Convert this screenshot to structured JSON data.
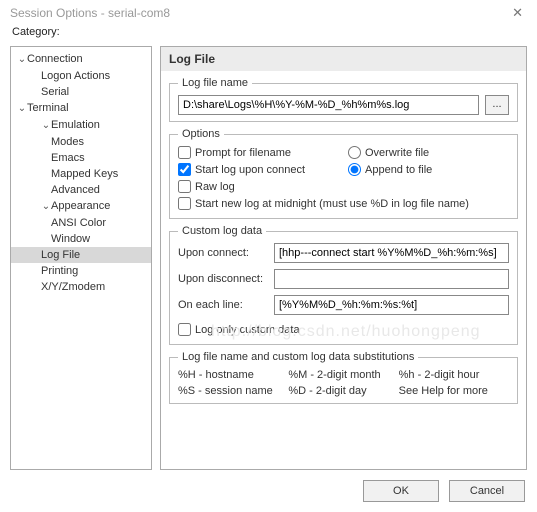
{
  "window": {
    "title": "Session Options - serial-com8",
    "close_glyph": "✕"
  },
  "sidebar": {
    "label": "Category:",
    "tree": {
      "connection": {
        "label": "Connection",
        "children": {
          "logon": "Logon Actions",
          "serial": "Serial"
        }
      },
      "terminal": {
        "label": "Terminal",
        "children": {
          "emulation": {
            "label": "Emulation",
            "children": {
              "modes": "Modes",
              "emacs": "Emacs",
              "mapped": "Mapped Keys",
              "advanced": "Advanced"
            }
          },
          "appearance": {
            "label": "Appearance",
            "children": {
              "ansi": "ANSI Color",
              "window": "Window"
            }
          },
          "logfile": "Log File",
          "printing": "Printing",
          "xyz": "X/Y/Zmodem"
        }
      }
    }
  },
  "panel": {
    "title": "Log File",
    "file_group": {
      "legend": "Log file name",
      "path": "D:\\share\\Logs\\%H\\%Y-%M-%D_%h%m%s.log",
      "browse": "..."
    },
    "options_group": {
      "legend": "Options",
      "prompt": "Prompt for filename",
      "start_on_connect": "Start log upon connect",
      "overwrite": "Overwrite file",
      "append": "Append to file",
      "raw": "Raw log",
      "midnight": "Start new log at midnight (must use %D in log file name)"
    },
    "custom_group": {
      "legend": "Custom log data",
      "upon_connect_label": "Upon connect:",
      "upon_connect_value": "[hhp---connect start %Y%M%D_%h:%m:%s]",
      "upon_disconnect_label": "Upon disconnect:",
      "upon_disconnect_value": "",
      "each_line_label": "On each line:",
      "each_line_value": "[%Y%M%D_%h:%m:%s:%t]",
      "log_only_custom": "Log only custom data"
    },
    "subs_group": {
      "legend": "Log file name and custom log data substitutions",
      "items": {
        "h_upper": "%H - hostname",
        "m_upper": "%M - 2-digit month",
        "h_lower": "%h - 2-digit hour",
        "s_upper": "%S - session name",
        "d_upper": "%D - 2-digit day",
        "help": "See Help for more"
      }
    }
  },
  "buttons": {
    "ok": "OK",
    "cancel": "Cancel"
  },
  "watermark": "http://blog.csdn.net/huohongpeng"
}
